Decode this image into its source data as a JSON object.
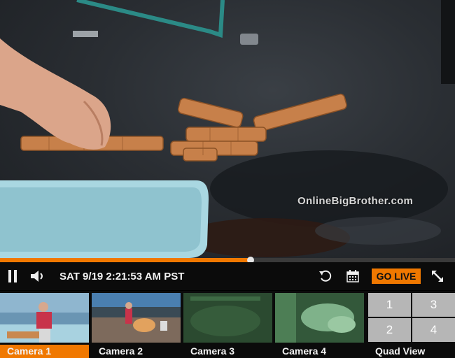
{
  "player": {
    "watermark": "OnlineBigBrother.com",
    "progress_percent": 55,
    "timestamp": "SAT 9/19 2:21:53 AM PST",
    "go_live_label": "GO LIVE",
    "accent_color": "#f07800"
  },
  "controls": {
    "icons": [
      "pause-icon",
      "volume-icon",
      "replay-icon",
      "calendar-icon",
      "fullscreen-icon"
    ]
  },
  "cameras": [
    {
      "label": "Camera 1",
      "active": true
    },
    {
      "label": "Camera 2",
      "active": false
    },
    {
      "label": "Camera 3",
      "active": false
    },
    {
      "label": "Camera 4",
      "active": false
    }
  ],
  "quad": {
    "label": "Quad View",
    "cells": [
      "1",
      "3",
      "2",
      "4"
    ]
  }
}
